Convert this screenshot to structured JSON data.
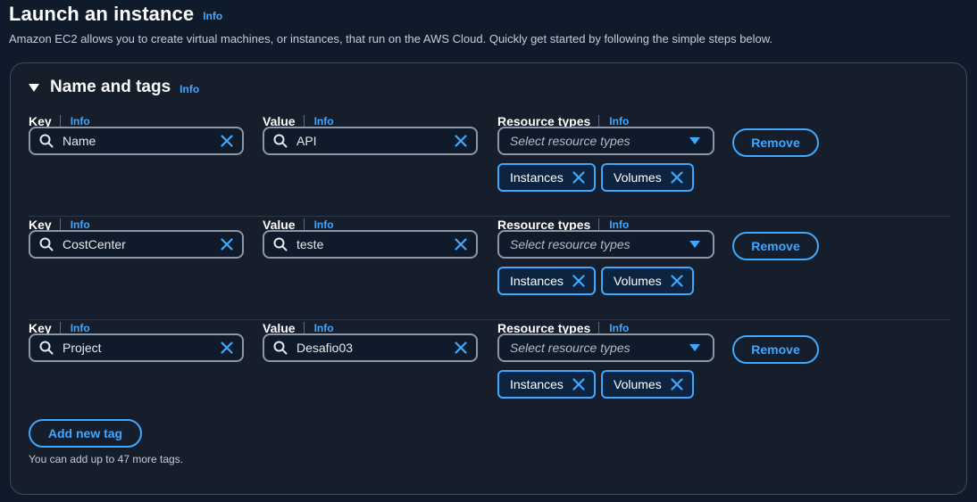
{
  "page": {
    "title": "Launch an instance",
    "info_label": "Info",
    "description": "Amazon EC2 allows you to create virtual machines, or instances, that run on the AWS Cloud. Quickly get started by following the simple steps below."
  },
  "section": {
    "title": "Name and tags",
    "info_label": "Info"
  },
  "labels": {
    "key": "Key",
    "value": "Value",
    "resource_types": "Resource types",
    "info": "Info",
    "select_placeholder": "Select resource types",
    "remove": "Remove"
  },
  "tags": [
    {
      "key": "Name",
      "value": "API",
      "resource_types": [
        "Instances",
        "Volumes"
      ]
    },
    {
      "key": "CostCenter",
      "value": "teste",
      "resource_types": [
        "Instances",
        "Volumes"
      ]
    },
    {
      "key": "Project",
      "value": "Desafio03",
      "resource_types": [
        "Instances",
        "Volumes"
      ]
    }
  ],
  "actions": {
    "add_tag": "Add new tag",
    "hint": "You can add up to 47 more tags."
  },
  "colors": {
    "background": "#0f1b2a",
    "panel": "#161d2b",
    "accent": "#3fa8ff",
    "input_border": "#8d98a6"
  },
  "icons": {
    "search": "search-icon",
    "clear": "close-icon",
    "dropdown": "caret-down-icon",
    "collapse": "caret-down-icon"
  }
}
